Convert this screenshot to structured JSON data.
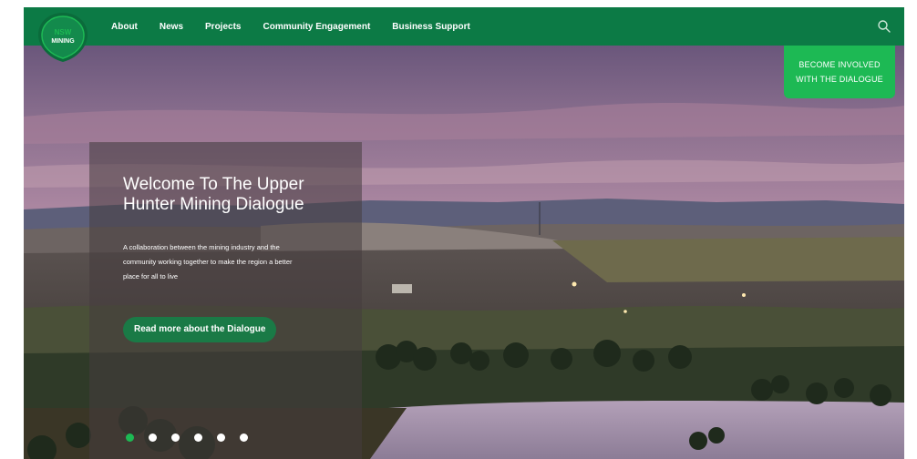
{
  "brand": {
    "logo_line1": "NSW",
    "logo_line2": "MINING",
    "primary_color": "#0c7a45",
    "accent_color": "#1db954"
  },
  "nav": {
    "items": [
      {
        "label": "About"
      },
      {
        "label": "News"
      },
      {
        "label": "Projects"
      },
      {
        "label": "Community Engagement"
      },
      {
        "label": "Business Support"
      }
    ],
    "search_icon": "search-icon"
  },
  "cta": {
    "line1": "BECOME INVOLVED",
    "line2": "WITH THE DIALOGUE"
  },
  "hero": {
    "title_line1": "Welcome To The Upper",
    "title_line2": "Hunter Mining Dialogue",
    "text_line1": "A collaboration between the mining industry and the",
    "text_line2": "community working together to make the region a better",
    "text_line3": "place for all to live",
    "button_label": "Read more about the Dialogue"
  },
  "carousel": {
    "slide_count": 6,
    "active_index": 0
  }
}
